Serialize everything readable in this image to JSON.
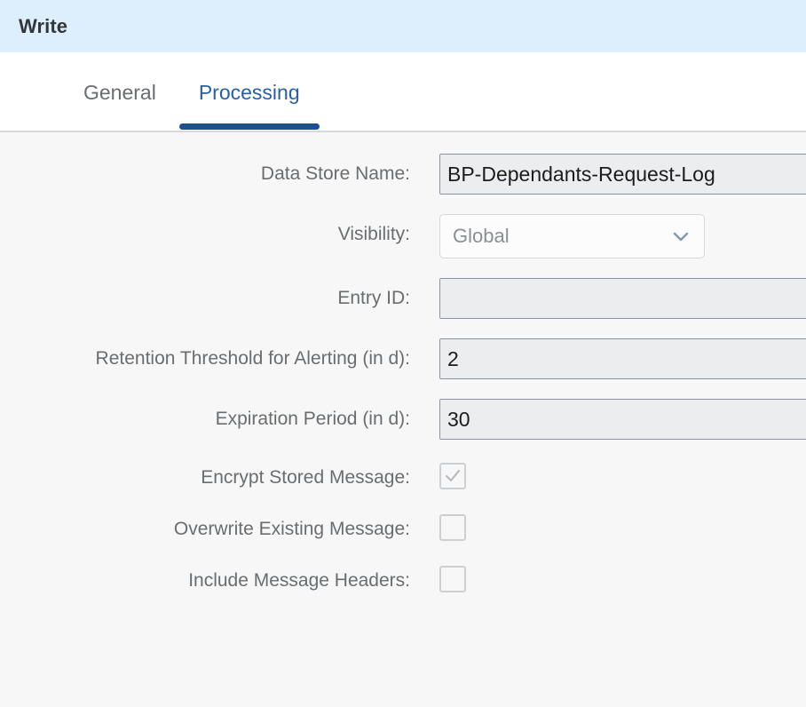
{
  "header": {
    "title": "Write"
  },
  "tabs": [
    {
      "label": "General",
      "active": false
    },
    {
      "label": "Processing",
      "active": true
    }
  ],
  "form": {
    "fields": [
      {
        "label": "Data Store Name:",
        "type": "text",
        "value": "BP-Dependants-Request-Log"
      },
      {
        "label": "Visibility:",
        "type": "select",
        "value": "Global",
        "icon": "chevron-down-icon"
      },
      {
        "label": "Entry ID:",
        "type": "text",
        "value": ""
      },
      {
        "label": "Retention Threshold for Alerting (in d):",
        "type": "text",
        "value": "2"
      },
      {
        "label": "Expiration Period (in d):",
        "type": "text",
        "value": "30"
      },
      {
        "label": "Encrypt Stored Message:",
        "type": "checkbox",
        "checked": true
      },
      {
        "label": "Overwrite Existing Message:",
        "type": "checkbox",
        "checked": false
      },
      {
        "label": "Include Message Headers:",
        "type": "checkbox",
        "checked": false
      }
    ]
  },
  "colors": {
    "header_bg": "#ddeefc",
    "accent": "#1d4f91",
    "tab_active_text": "#2a5fa5",
    "label_text": "#6a6d70",
    "input_bg": "#ebedef",
    "input_border": "#8b93a0",
    "body_bg": "#f7f7f7"
  }
}
